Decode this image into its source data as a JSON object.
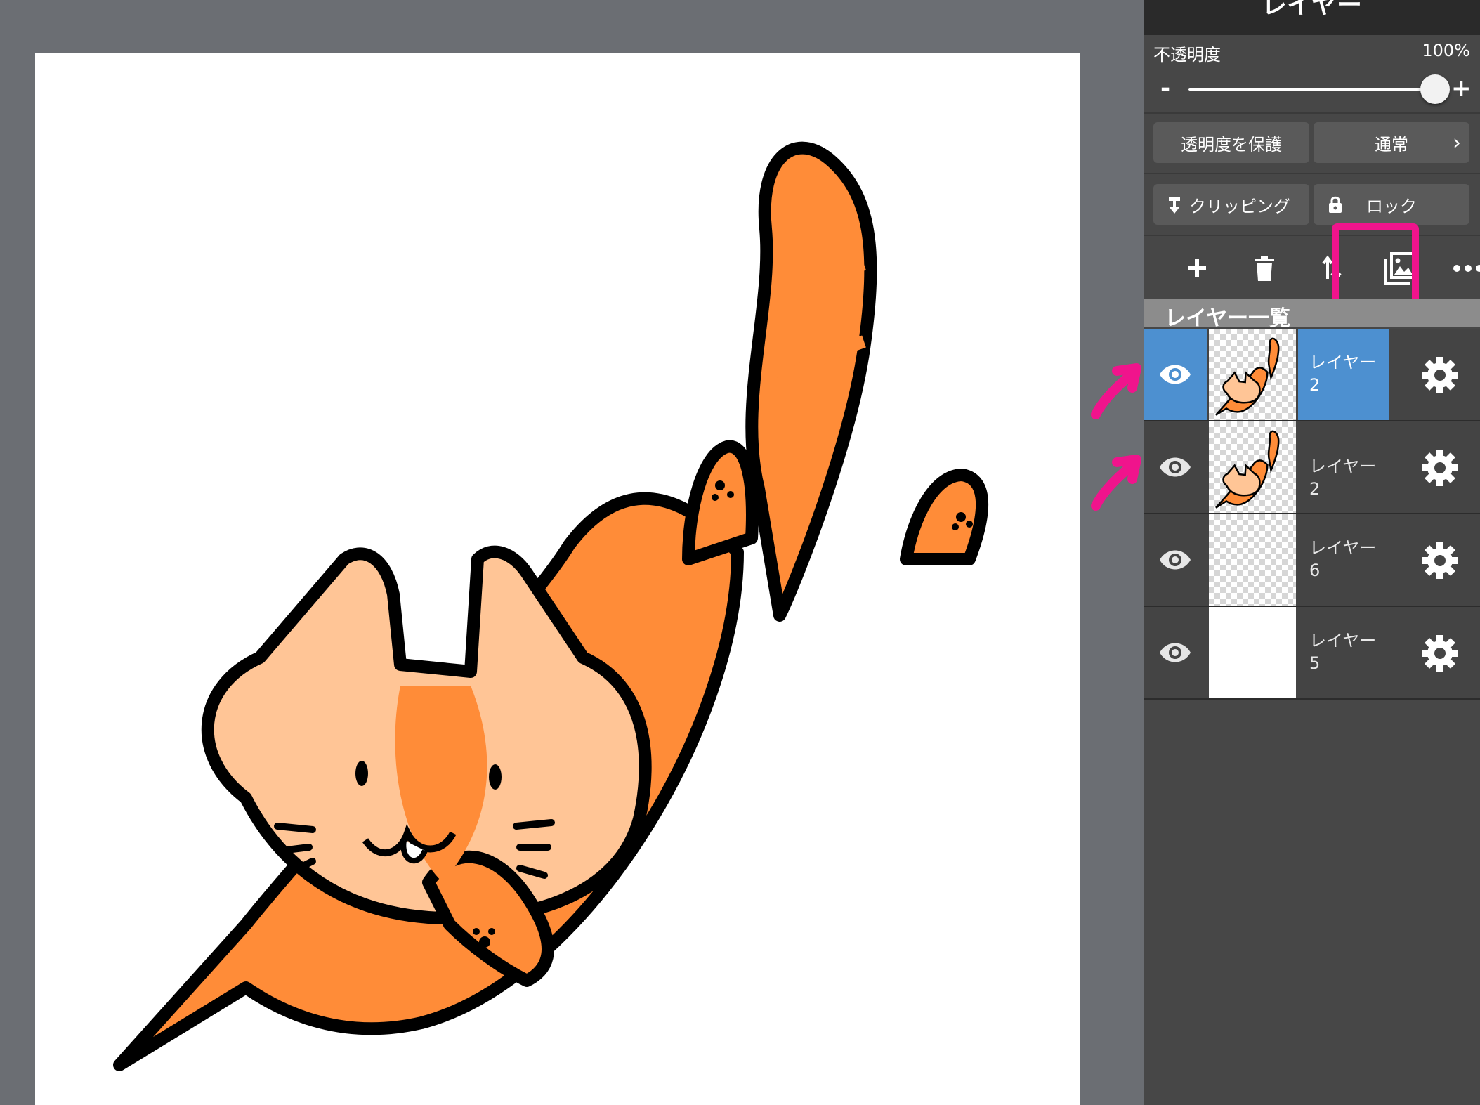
{
  "panel": {
    "title": "レイヤー",
    "opacity": {
      "label": "不透明度",
      "value": "100%",
      "minus": "-",
      "plus": "+",
      "level": 1.0
    },
    "buttons": {
      "protect_alpha": "透明度を保護",
      "blend_mode": "通常",
      "clipping": "クリッピング",
      "lock": "ロック"
    },
    "toolbar": [
      "add-layer",
      "delete-layer",
      "move-layer",
      "merge-layer",
      "more"
    ],
    "layer_list_title": "レイヤー一覧",
    "layers": [
      {
        "name": "レイヤー2",
        "selected": true,
        "visible": true,
        "thumb": "cat"
      },
      {
        "name": "レイヤー2",
        "selected": false,
        "visible": true,
        "thumb": "cat"
      },
      {
        "name": "レイヤー6",
        "selected": false,
        "visible": true,
        "thumb": "empty"
      },
      {
        "name": "レイヤー5",
        "selected": false,
        "visible": true,
        "thumb": "white"
      }
    ]
  },
  "colors": {
    "accent": "#4d90d0",
    "highlight": "#f0148c",
    "cat_orange": "#ff8c38",
    "cat_light": "#ffc596"
  }
}
